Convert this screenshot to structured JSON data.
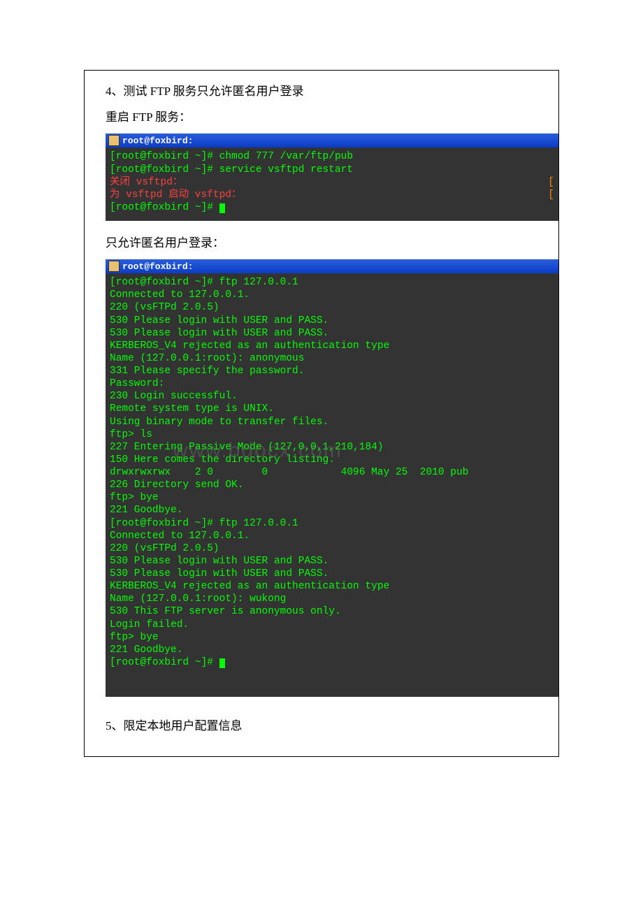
{
  "section4_title": "4、测试 FTP 服务只允许匿名用户登录",
  "restart_label": "重启 FTP 服务：",
  "terminal1_titlebar": "root@foxbird:",
  "terminal1": {
    "l1": "[root@foxbird ~]# chmod 777 /var/ftp/pub",
    "l2": "[root@foxbird ~]# service vsftpd restart",
    "l3a": "关闭 vsftpd：",
    "l3b": "[",
    "l4a": "为 vsftpd 启动 vsftpd：",
    "l4b": "[",
    "l5": "[root@foxbird ~]# "
  },
  "anon_label": "只允许匿名用户登录：",
  "terminal2_titlebar": "root@foxbird:",
  "terminal2": {
    "l1": "[root@foxbird ~]# ftp 127.0.0.1",
    "l2": "Connected to 127.0.0.1.",
    "l3": "220 (vsFTPd 2.0.5)",
    "l4": "530 Please login with USER and PASS.",
    "l5": "530 Please login with USER and PASS.",
    "l6": "KERBEROS_V4 rejected as an authentication type",
    "l7": "Name (127.0.0.1:root): anonymous",
    "l8": "331 Please specify the password.",
    "l9": "Password:",
    "l10": "230 Login successful.",
    "l11": "Remote system type is UNIX.",
    "l12": "Using binary mode to transfer files.",
    "l13": "ftp> ls",
    "l14": "227 Entering Passive Mode (127,0,0,1,210,184)",
    "l15": "150 Here comes the directory listing.",
    "l16": "drwxrwxrwx    2 0        0            4096 May 25  2010 pub",
    "l17": "226 Directory send OK.",
    "l18": "ftp> bye",
    "l19": "221 Goodbye.",
    "l20": "[root@foxbird ~]# ftp 127.0.0.1",
    "l21": "Connected to 127.0.0.1.",
    "l22": "220 (vsFTPd 2.0.5)",
    "l23": "530 Please login with USER and PASS.",
    "l24": "530 Please login with USER and PASS.",
    "l25": "KERBEROS_V4 rejected as an authentication type",
    "l26": "Name (127.0.0.1:root): wukong",
    "l27": "530 This FTP server is anonymous only.",
    "l28": "Login failed.",
    "l29": "ftp> bye",
    "l30": "221 Goodbye.",
    "l31": "[root@foxbird ~]# "
  },
  "watermark": "www.bdocx.com",
  "section5_title": "5、限定本地用户配置信息"
}
